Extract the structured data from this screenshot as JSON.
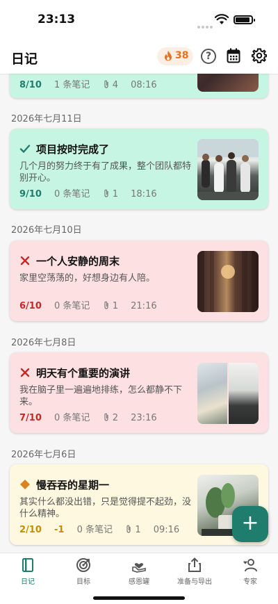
{
  "status_bar": {
    "time": "23:13"
  },
  "header": {
    "title": "日记",
    "streak_count": "38"
  },
  "entries": [
    {
      "mood": "positive",
      "score": "8/10",
      "notes": "1 条笔记",
      "attachments": "4",
      "time": "08:16"
    },
    {
      "date": "2026年七月11日",
      "mood": "positive",
      "title": "项目按时完成了",
      "body": "几个月的努力终于有了成果，整个团队都特别开心。",
      "score": "9/10",
      "notes": "0 条笔记",
      "attachments": "1",
      "time": "18:16"
    },
    {
      "date": "2026年七月10日",
      "mood": "negative",
      "title": "一个人安静的周末",
      "body": "家里空荡荡的，好想身边有人陪。",
      "score": "6/10",
      "notes": "0 条笔记",
      "attachments": "1",
      "time": "21:16"
    },
    {
      "date": "2026年七月8日",
      "mood": "negative",
      "title": "明天有个重要的演讲",
      "body": "我在脑子里一遍遍地排练，怎么都静不下来。",
      "score": "7/10",
      "notes": "0 条笔记",
      "attachments": "2",
      "time": "23:16"
    },
    {
      "date": "2026年七月6日",
      "mood": "neutral",
      "title": "慢吞吞的星期一",
      "body": "其实什么都没出错，只是觉得提不起劲，没什么精神。",
      "score": "2/10",
      "delta": "-1",
      "notes": "0 条笔记",
      "attachments": "1",
      "time": "09:16"
    }
  ],
  "fab": {
    "label": "+"
  },
  "tabbar": {
    "tabs": [
      {
        "label": "日记",
        "icon": "book-icon",
        "active": true
      },
      {
        "label": "目标",
        "icon": "target-icon"
      },
      {
        "label": "感恩罐",
        "icon": "gratitude-jar-icon"
      },
      {
        "label": "准备与导出",
        "icon": "share-export-icon"
      },
      {
        "label": "专家",
        "icon": "expert-icon"
      }
    ]
  },
  "colors": {
    "accent": "#1f7d6e",
    "positive_card": "#c7f5e4",
    "negative_card": "#fde0e1",
    "neutral_card": "#fdf8df",
    "streak": "#e8711f"
  }
}
